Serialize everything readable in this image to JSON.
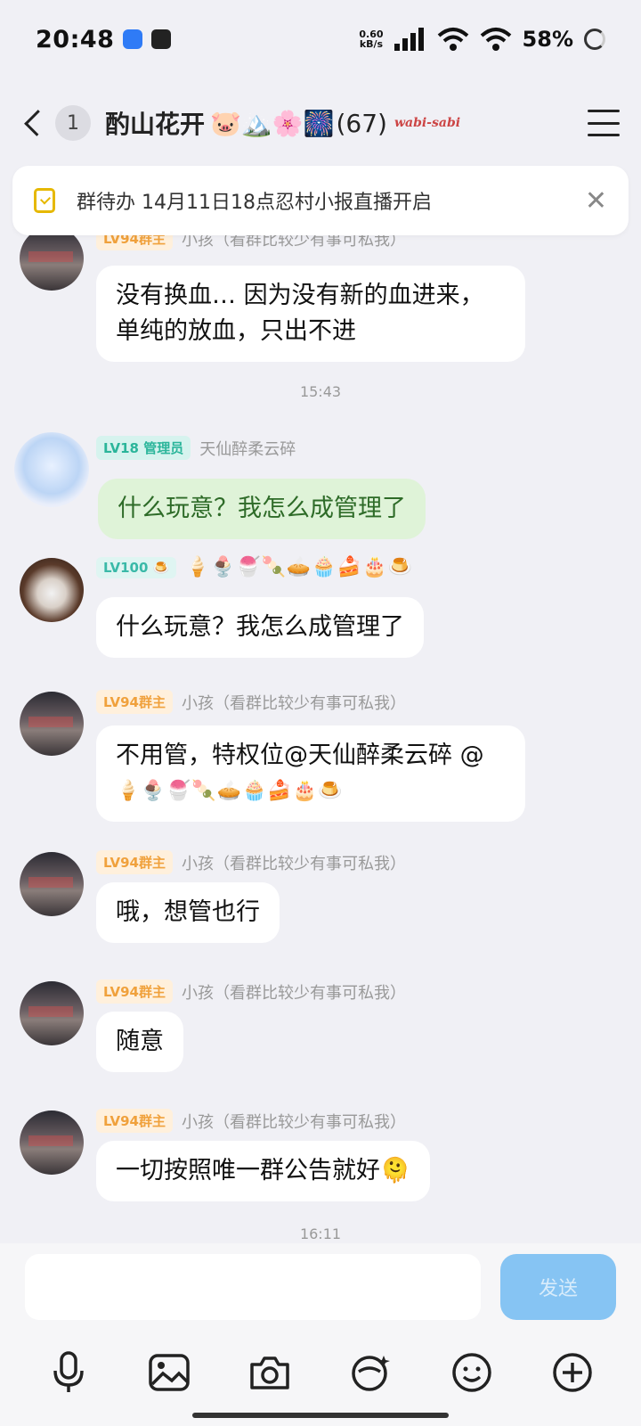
{
  "status_bar": {
    "time": "20:48",
    "net_speed_value": "0.60",
    "net_speed_unit": "kB/s",
    "battery": "58%"
  },
  "header": {
    "unread_count": "1",
    "title": "酌山花开",
    "title_emojis": "🐷🏔️🌸🎆",
    "member_count": "(67)",
    "brand": "wabi-sabi"
  },
  "todo": {
    "text": "群待办 14月11日18点忍村小报直播开启"
  },
  "messages": [
    {
      "badge": "LV94群主",
      "name": "小孩（看群比较少有事可私我）",
      "text": "没有换血… 因为没有新的血进来，单纯的放血，只出不进"
    },
    {
      "time": "15:43"
    },
    {
      "badge": "LV18 管理员",
      "name": "天仙醉柔云碎",
      "text": "什么玩意？我怎么成管理了"
    },
    {
      "badge": "LV100 🍮",
      "name": "🍦🍨🍧🍡🥧🧁🍰🎂🍮",
      "text": "什么玩意？我怎么成管理了"
    },
    {
      "badge": "LV94群主",
      "name": "小孩（看群比较少有事可私我）",
      "text": "不用管，特权位@天仙醉柔云碎 @",
      "text2": "🍦🍨🍧🍡🥧🧁🍰🎂🍮"
    },
    {
      "badge": "LV94群主",
      "name": "小孩（看群比较少有事可私我）",
      "text": "哦，想管也行"
    },
    {
      "badge": "LV94群主",
      "name": "小孩（看群比较少有事可私我）",
      "text": "随意"
    },
    {
      "badge": "LV94群主",
      "name": "小孩（看群比较少有事可私我）",
      "text": "一切按照唯一群公告就好🫠"
    },
    {
      "time": "16:11"
    }
  ],
  "composer": {
    "send_label": "发送"
  },
  "icons": [
    "mic-icon",
    "image-icon",
    "camera-icon",
    "sticker-icon",
    "emoji-icon",
    "plus-icon"
  ]
}
